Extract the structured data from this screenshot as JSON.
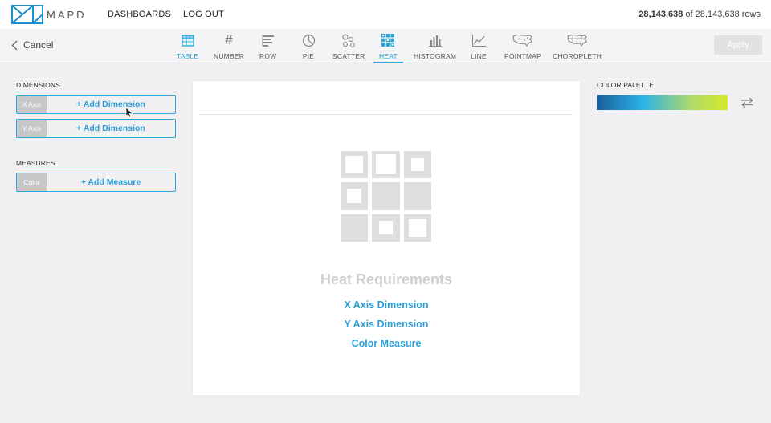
{
  "topnav": {
    "logo_text": "MAPD",
    "dashboards": "DASHBOARDS",
    "logout": "LOG OUT",
    "row_count_bold": "28,143,638",
    "row_count_rest": " of 28,143,638 rows"
  },
  "toolbar": {
    "cancel": "Cancel",
    "apply": "Apply",
    "chart_types": [
      "TABLE",
      "NUMBER",
      "ROW",
      "PIE",
      "SCATTER",
      "HEAT",
      "HISTOGRAM",
      "LINE",
      "POINTMAP",
      "CHOROPLETH"
    ],
    "active": "HEAT",
    "accent_color": "#22a7d8"
  },
  "left": {
    "dimensions_label": "DIMENSIONS",
    "x_tag": "X Axis",
    "y_tag": "Y Axis",
    "add_dimension": "+ Add Dimension",
    "measures_label": "MEASURES",
    "color_tag": "Color",
    "add_measure": "+ Add Measure"
  },
  "main": {
    "requirements_title": "Heat Requirements",
    "requirements": [
      "X Axis Dimension",
      "Y Axis Dimension",
      "Color Measure"
    ]
  },
  "right": {
    "palette_label": "COLOR PALETTE",
    "palette_colors": [
      "#1a5f9a",
      "#2bb2e8",
      "#aed96b",
      "#d6ea2a"
    ]
  }
}
